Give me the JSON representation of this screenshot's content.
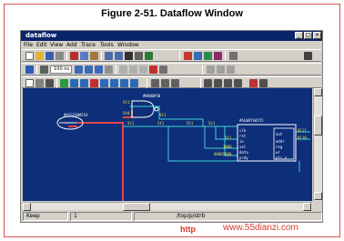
{
  "figure_caption": "Figure 2-51. Dataflow Window",
  "window": {
    "title": "dataflow",
    "buttons": {
      "minimize": "_",
      "maximize": "□",
      "close": "×"
    }
  },
  "menu": [
    "File",
    "Edit",
    "View",
    "Add",
    "Trace",
    "Tools",
    "Window"
  ],
  "toolbar2": {
    "zoom_value": "100 ns"
  },
  "canvas": {
    "instances": {
      "left_block": "#ASSIGN#254",
      "middle_block": "#NAND#50",
      "right_block": "#ALWAYS#155"
    },
    "signals": {
      "st1_top": "St1",
      "st0_a": "St0",
      "st1_b": "St1",
      "st1_c": "St1",
      "st1_d": "St1",
      "st1_e": "St1",
      "st1_f": "St1",
      "st1_g": "St1",
      "val_1000": "1000",
      "val_00001000": "00001000",
      "val_0111": "0111",
      "val_0110": "0110"
    },
    "ports": [
      "clk",
      "rst",
      "in",
      "out",
      "sel",
      "data",
      "prdy",
      "addr",
      "reg",
      "wr",
      "ptr_o"
    ]
  },
  "statusbar": {
    "mode": "Keep",
    "count": "1",
    "path": "/top/p/strb"
  },
  "watermark": {
    "left": "http",
    "right": "www.55dianzi.com"
  },
  "colors": {
    "canvas": "#0d2e78",
    "titlebar": "#0a246a",
    "highlight_wire": "#e0464a",
    "signal_wire": "#3fd3d8",
    "watermark": "#d23a2a"
  }
}
